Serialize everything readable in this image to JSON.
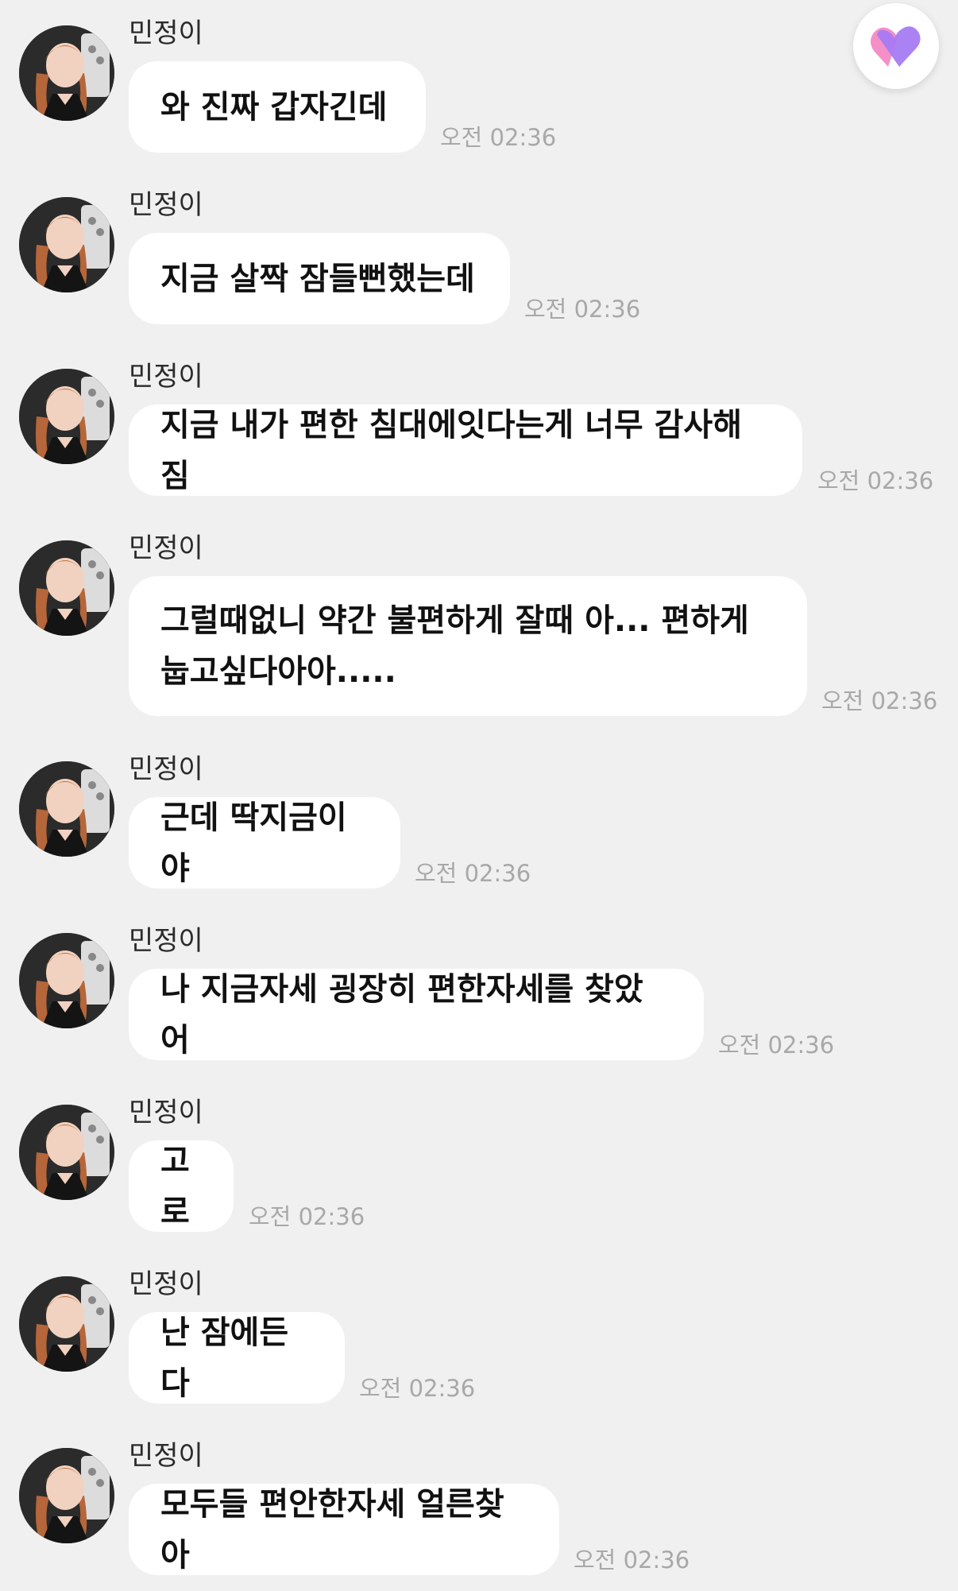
{
  "messages": [
    {
      "sender": "민정이",
      "text": "와 진짜 갑자긴데",
      "time": "오전 02:36"
    },
    {
      "sender": "민정이",
      "text": "지금 살짝 잠들뻔했는데",
      "time": "오전 02:36"
    },
    {
      "sender": "민정이",
      "text": "지금 내가 편한 침대에잇다는게 너무 감사해짐",
      "time": "오전 02:36"
    },
    {
      "sender": "민정이",
      "text": "그럴때없니 약간 불편하게 잘때 아... 편하게\n눕고싶다아아.....",
      "time": "오전 02:36"
    },
    {
      "sender": "민정이",
      "text": "근데 딱지금이야",
      "time": "오전 02:36"
    },
    {
      "sender": "민정이",
      "text": "나 지금자세 굉장히 편한자세를 찾았어",
      "time": "오전 02:36"
    },
    {
      "sender": "민정이",
      "text": "고로",
      "time": "오전 02:36"
    },
    {
      "sender": "민정이",
      "text": "난 잠에든다",
      "time": "오전 02:36"
    },
    {
      "sender": "민정이",
      "text": "모두들 편안한자세 얼른찾아",
      "time": "오전 02:36"
    }
  ],
  "heart_button": {
    "icon": "heart-icon",
    "colors": [
      "#f48fc7",
      "#a77bf3"
    ]
  },
  "colors": {
    "background": "#f0f0f0",
    "bubble": "#ffffff",
    "text": "#111111",
    "time": "#a8a8a8"
  }
}
